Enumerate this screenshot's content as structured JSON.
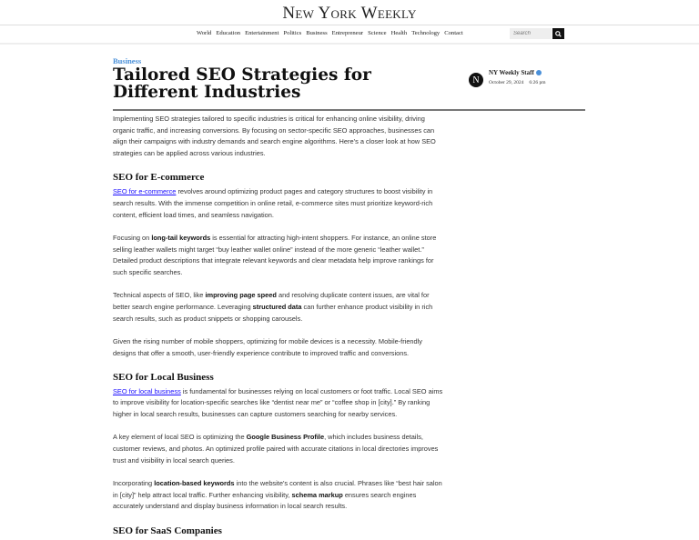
{
  "site": {
    "name": "New York Weekly"
  },
  "nav": {
    "items": [
      "World",
      "Education",
      "Entertainment",
      "Politics",
      "Business",
      "Entrepreneur",
      "Science",
      "Health",
      "Technology",
      "Contact"
    ]
  },
  "search": {
    "placeholder": "Search",
    "icon": "search-icon"
  },
  "article": {
    "category": "Business",
    "title": "Tailored SEO Strategies for Different Industries",
    "author": {
      "initial": "N",
      "name": "NY Weekly Staff",
      "date": "October 29, 2024",
      "time": "6:26 pm",
      "accent": "#4a90d9"
    },
    "blocks": [
      {
        "type": "p",
        "segments": [
          {
            "t": "Implementing SEO strategies tailored to specific industries is critical for enhancing online visibility, driving organic traffic, and increasing conversions. By focusing on sector-specific SEO approaches, businesses can align their campaigns with industry demands and search engine algorithms. Here’s a closer look at how SEO strategies can be applied across various industries."
          }
        ]
      },
      {
        "type": "h2",
        "text": "SEO for E-commerce"
      },
      {
        "type": "p",
        "segments": [
          {
            "t": "SEO for e-commerce",
            "link": true
          },
          {
            "t": " revolves around optimizing product pages and category structures to boost visibility in search results. With the immense competition in online retail, e-commerce sites must prioritize keyword-rich content, efficient load times, and seamless navigation."
          }
        ]
      },
      {
        "type": "p",
        "segments": [
          {
            "t": "Focusing on "
          },
          {
            "t": "long-tail keywords",
            "b": true
          },
          {
            "t": " is essential for attracting high-intent shoppers. For instance, an online store selling leather wallets might target “buy leather wallet online” instead of the more generic “leather wallet.” Detailed product descriptions that integrate relevant keywords and clear metadata help improve rankings for such specific searches."
          }
        ]
      },
      {
        "type": "p",
        "segments": [
          {
            "t": "Technical aspects of SEO, like "
          },
          {
            "t": "improving page speed",
            "b": true
          },
          {
            "t": " and resolving duplicate content issues, are vital for better search engine performance. Leveraging "
          },
          {
            "t": "structured data",
            "b": true
          },
          {
            "t": " can further enhance product visibility in rich search results, such as product snippets or shopping carousels."
          }
        ]
      },
      {
        "type": "p",
        "segments": [
          {
            "t": "Given the rising number of mobile shoppers, optimizing for mobile devices is a necessity. Mobile-friendly designs that offer a smooth, user-friendly experience contribute to improved traffic and conversions."
          }
        ]
      },
      {
        "type": "h2",
        "text": "SEO for Local Business"
      },
      {
        "type": "p",
        "segments": [
          {
            "t": "SEO for local business",
            "link": true
          },
          {
            "t": " is fundamental for businesses relying on local customers or foot traffic. Local SEO aims to improve visibility for location-specific searches like “dentist near me” or “coffee shop in [city].” By ranking higher in local search results, businesses can capture customers searching for nearby services."
          }
        ]
      },
      {
        "type": "p",
        "segments": [
          {
            "t": "A key element of local SEO is optimizing the "
          },
          {
            "t": "Google Business Profile",
            "b": true
          },
          {
            "t": ", which includes business details, customer reviews, and photos. An optimized profile paired with accurate citations in local directories improves trust and visibility in local search queries."
          }
        ]
      },
      {
        "type": "p",
        "segments": [
          {
            "t": "Incorporating "
          },
          {
            "t": "location-based keywords",
            "b": true
          },
          {
            "t": " into the website’s content is also crucial. Phrases like “best hair salon in [city]” help attract local traffic. Further enhancing visibility, "
          },
          {
            "t": "schema markup",
            "b": true
          },
          {
            "t": " ensures search engines accurately understand and display business information in local search results."
          }
        ]
      },
      {
        "type": "h2",
        "text": "SEO for SaaS Companies"
      }
    ]
  }
}
